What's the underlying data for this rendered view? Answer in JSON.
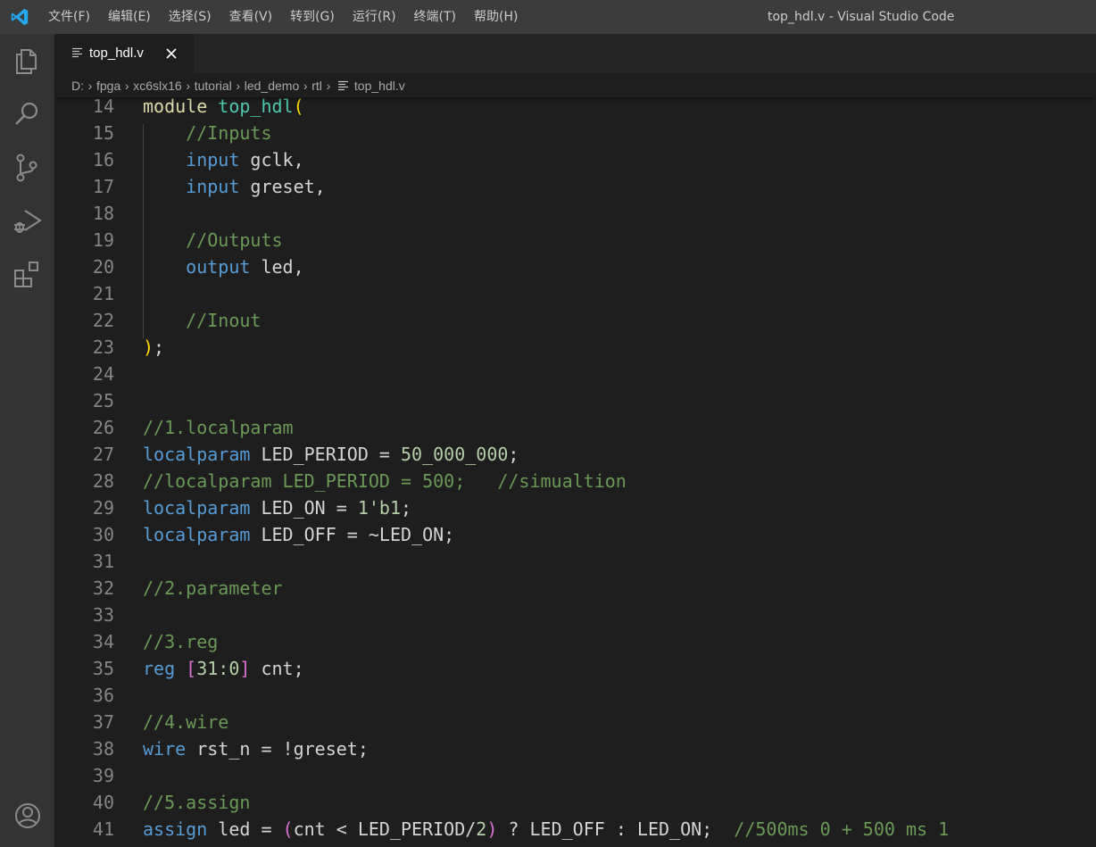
{
  "menu": [
    "文件(F)",
    "编辑(E)",
    "选择(S)",
    "查看(V)",
    "转到(G)",
    "运行(R)",
    "终端(T)",
    "帮助(H)"
  ],
  "window_title": "top_hdl.v - Visual Studio Code",
  "activity_icons": [
    "explorer-icon",
    "search-icon",
    "source-control-icon",
    "run-debug-icon",
    "extensions-icon",
    "account-icon"
  ],
  "tab": {
    "label": "top_hdl.v",
    "close": "✕"
  },
  "breadcrumb": [
    "D:",
    "fpga",
    "xc6slx16",
    "tutorial",
    "led_demo",
    "rtl",
    "top_hdl.v"
  ],
  "lines": [
    {
      "n": "14",
      "tokens": [
        [
          "module",
          "mod"
        ],
        [
          " ",
          "txt"
        ],
        [
          "top_hdl",
          "fn"
        ],
        [
          "(",
          "p1"
        ]
      ]
    },
    {
      "n": "15",
      "tokens": [
        [
          "    ",
          "txt"
        ],
        [
          "//Inputs",
          "cm"
        ]
      ]
    },
    {
      "n": "16",
      "tokens": [
        [
          "    ",
          "txt"
        ],
        [
          "input",
          "kw"
        ],
        [
          " gclk,",
          "txt"
        ]
      ]
    },
    {
      "n": "17",
      "tokens": [
        [
          "    ",
          "txt"
        ],
        [
          "input",
          "kw"
        ],
        [
          " greset,",
          "txt"
        ]
      ]
    },
    {
      "n": "18",
      "tokens": []
    },
    {
      "n": "19",
      "tokens": [
        [
          "    ",
          "txt"
        ],
        [
          "//Outputs",
          "cm"
        ]
      ]
    },
    {
      "n": "20",
      "tokens": [
        [
          "    ",
          "txt"
        ],
        [
          "output",
          "kw"
        ],
        [
          " led,",
          "txt"
        ]
      ]
    },
    {
      "n": "21",
      "tokens": []
    },
    {
      "n": "22",
      "tokens": [
        [
          "    ",
          "txt"
        ],
        [
          "//Inout",
          "cm"
        ]
      ]
    },
    {
      "n": "23",
      "tokens": [
        [
          ")",
          "p1"
        ],
        [
          ";",
          "txt"
        ]
      ]
    },
    {
      "n": "24",
      "tokens": []
    },
    {
      "n": "25",
      "tokens": []
    },
    {
      "n": "26",
      "tokens": [
        [
          "//1.localparam",
          "cm"
        ]
      ]
    },
    {
      "n": "27",
      "tokens": [
        [
          "localparam",
          "kw"
        ],
        [
          " LED_PERIOD = ",
          "txt"
        ],
        [
          "50_000_000",
          "num"
        ],
        [
          ";",
          "txt"
        ]
      ]
    },
    {
      "n": "28",
      "tokens": [
        [
          "//localparam LED_PERIOD = 500;   //simualtion",
          "cm"
        ]
      ]
    },
    {
      "n": "29",
      "tokens": [
        [
          "localparam",
          "kw"
        ],
        [
          " LED_ON = ",
          "txt"
        ],
        [
          "1'b1",
          "num"
        ],
        [
          ";",
          "txt"
        ]
      ]
    },
    {
      "n": "30",
      "tokens": [
        [
          "localparam",
          "kw"
        ],
        [
          " LED_OFF = ~LED_ON;",
          "txt"
        ]
      ]
    },
    {
      "n": "31",
      "tokens": []
    },
    {
      "n": "32",
      "tokens": [
        [
          "//2.parameter",
          "cm"
        ]
      ]
    },
    {
      "n": "33",
      "tokens": []
    },
    {
      "n": "34",
      "tokens": [
        [
          "//3.reg",
          "cm"
        ]
      ]
    },
    {
      "n": "35",
      "tokens": [
        [
          "reg",
          "kw"
        ],
        [
          " ",
          "txt"
        ],
        [
          "[",
          "p2"
        ],
        [
          "31:0",
          "num"
        ],
        [
          "]",
          "p2"
        ],
        [
          " cnt;",
          "txt"
        ]
      ]
    },
    {
      "n": "36",
      "tokens": []
    },
    {
      "n": "37",
      "tokens": [
        [
          "//4.wire",
          "cm"
        ]
      ]
    },
    {
      "n": "38",
      "tokens": [
        [
          "wire",
          "kw"
        ],
        [
          " rst_n = !greset;",
          "txt"
        ]
      ]
    },
    {
      "n": "39",
      "tokens": []
    },
    {
      "n": "40",
      "tokens": [
        [
          "//5.assign",
          "cm"
        ]
      ]
    },
    {
      "n": "41",
      "tokens": [
        [
          "assign",
          "kw"
        ],
        [
          " led = ",
          "txt"
        ],
        [
          "(",
          "p2"
        ],
        [
          "cnt < LED_PERIOD/",
          "txt"
        ],
        [
          "2",
          "num"
        ],
        [
          ")",
          "p2"
        ],
        [
          " ? LED_OFF : LED_ON;  ",
          "txt"
        ],
        [
          "//500ms 0 + 500 ms 1",
          "cm"
        ]
      ]
    }
  ]
}
